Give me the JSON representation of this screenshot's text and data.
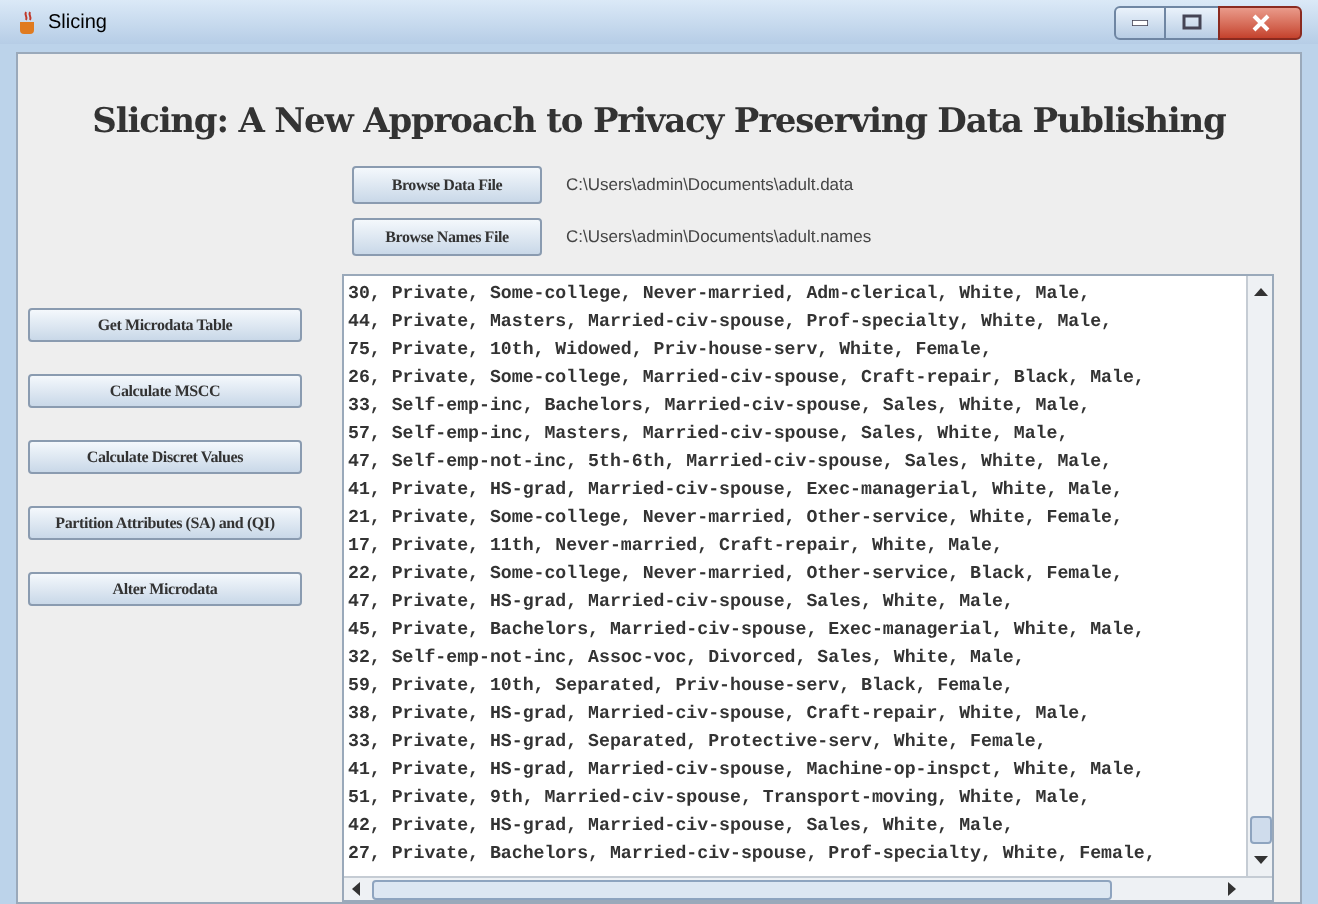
{
  "window": {
    "title": "Slicing"
  },
  "heading": "Slicing: A New Approach to Privacy Preserving Data Publishing",
  "files": [
    {
      "button": "Browse Data File",
      "path": "C:\\Users\\admin\\Documents\\adult.data"
    },
    {
      "button": "Browse Names File",
      "path": "C:\\Users\\admin\\Documents\\adult.names"
    }
  ],
  "actions": [
    "Get Microdata Table",
    "Calculate MSCC",
    "Calculate Discret Values",
    "Partition Attributes (SA) and (QI)",
    "Alter Microdata"
  ],
  "records": [
    "30, Private, Some-college, Never-married, Adm-clerical, White, Male,",
    "44, Private, Masters, Married-civ-spouse, Prof-specialty, White, Male,",
    "75, Private, 10th, Widowed, Priv-house-serv, White, Female,",
    "26, Private, Some-college, Married-civ-spouse, Craft-repair, Black, Male,",
    "33, Self-emp-inc, Bachelors, Married-civ-spouse, Sales, White, Male,",
    "57, Self-emp-inc, Masters, Married-civ-spouse, Sales, White, Male,",
    "47, Self-emp-not-inc, 5th-6th, Married-civ-spouse, Sales, White, Male,",
    "41, Private, HS-grad, Married-civ-spouse, Exec-managerial, White, Male,",
    "21, Private, Some-college, Never-married, Other-service, White, Female,",
    "17, Private, 11th, Never-married, Craft-repair, White, Male,",
    "22, Private, Some-college, Never-married, Other-service, Black, Female,",
    "47, Private, HS-grad, Married-civ-spouse, Sales, White, Male,",
    "45, Private, Bachelors, Married-civ-spouse, Exec-managerial, White, Male,",
    "32, Self-emp-not-inc, Assoc-voc, Divorced, Sales, White, Male,",
    "59, Private, 10th, Separated, Priv-house-serv, Black, Female,",
    "38, Private, HS-grad, Married-civ-spouse, Craft-repair, White, Male,",
    "33, Private, HS-grad, Separated, Protective-serv, White, Female,",
    "41, Private, HS-grad, Married-civ-spouse, Machine-op-inspct, White, Male,",
    "51, Private, 9th, Married-civ-spouse, Transport-moving, White, Male,",
    "42, Private, HS-grad, Married-civ-spouse, Sales, White, Male,",
    "27, Private, Bachelors, Married-civ-spouse, Prof-specialty, White, Female,"
  ]
}
